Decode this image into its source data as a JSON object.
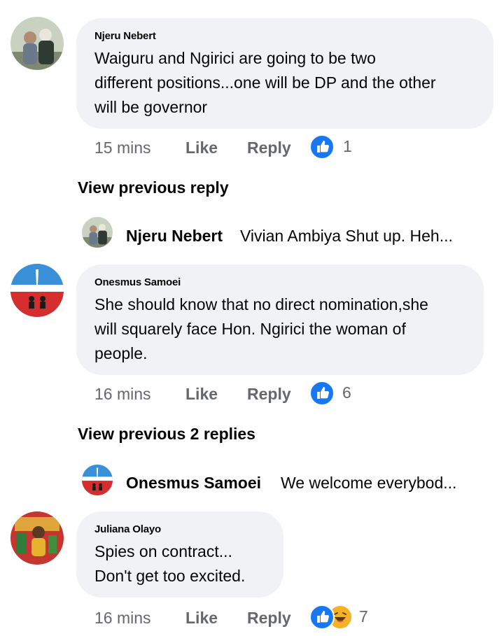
{
  "comments": [
    {
      "author": "Njeru Nebert",
      "text_lines": [
        "Waiguru and Ngirici are going to be two",
        "different positions...one will be DP and the other",
        "will be governor"
      ],
      "time": "15 mins",
      "like_label": "Like",
      "reply_label": "Reply",
      "reaction_count": "1",
      "reactions": [
        "like-icon"
      ]
    },
    {
      "author": "Onesmus Samoei",
      "text_lines": [
        "She should know that no direct nomination,she",
        "will squarely face Hon. Ngirici the woman of",
        "people."
      ],
      "time": "16 mins",
      "like_label": "Like",
      "reply_label": "Reply",
      "reaction_count": "6",
      "reactions": [
        "like-icon"
      ]
    },
    {
      "author": "Juliana Olayo",
      "text_lines": [
        "Spies on contract...",
        "Don't get too excited."
      ],
      "time": "16 mins",
      "like_label": "Like",
      "reply_label": "Reply",
      "reaction_count": "7",
      "reactions": [
        "like-icon",
        "haha-icon"
      ]
    }
  ],
  "threads": [
    {
      "view_previous": "View previous reply",
      "latest_reply": {
        "author": "Njeru Nebert",
        "snippet": "Vivian Ambiya Shut up.  Heh..."
      }
    },
    {
      "view_previous": "View previous 2 replies",
      "latest_reply": {
        "author": "Onesmus Samoei",
        "snippet": "We welcome everybod..."
      }
    }
  ],
  "colors": {
    "bubble": "#f0f2f5",
    "meta_text": "#65676b",
    "like_blue": "#1877f2",
    "haha_yellow": "#f7b125"
  }
}
